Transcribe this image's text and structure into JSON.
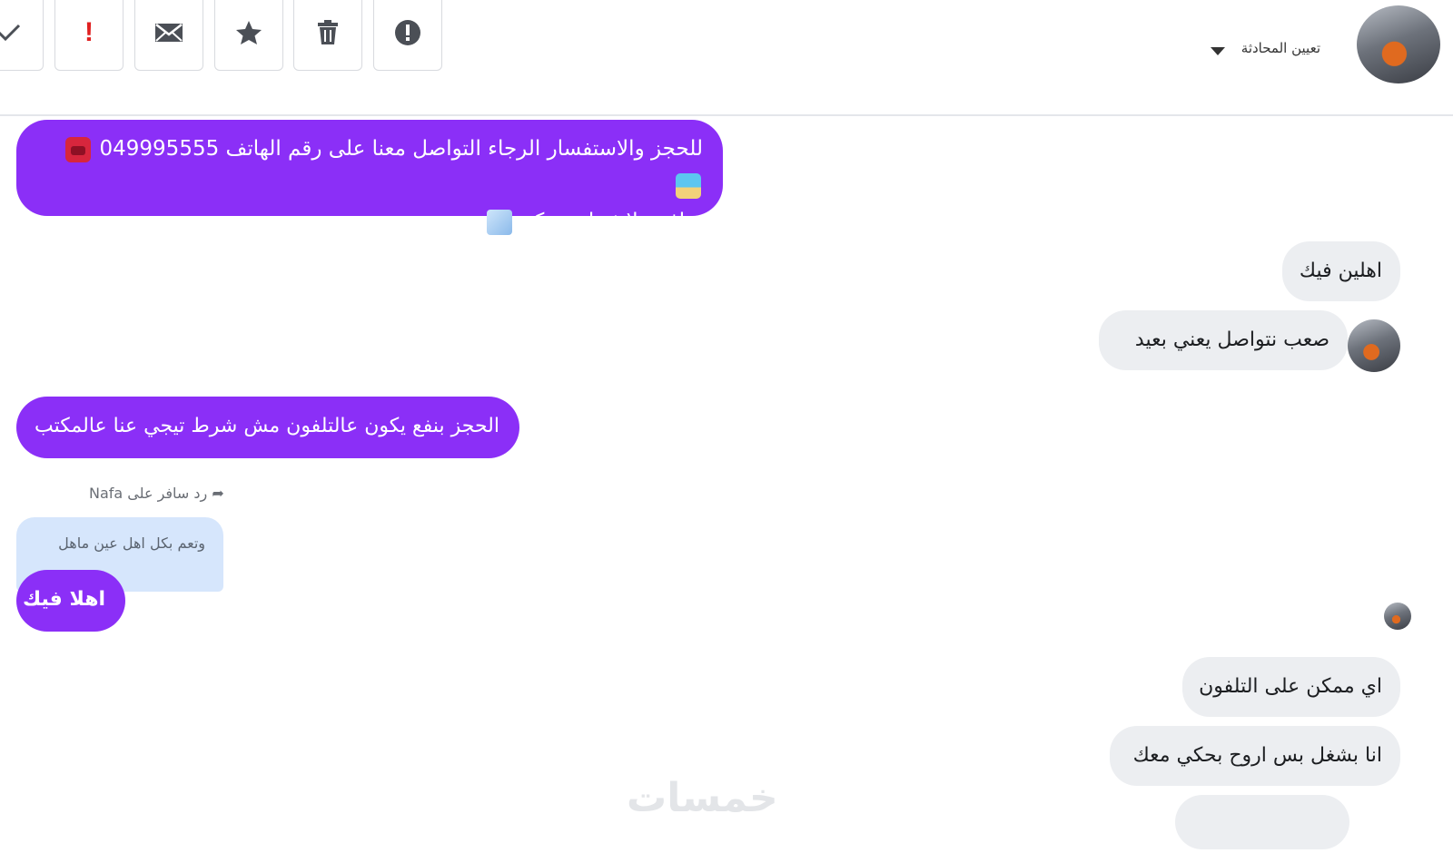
{
  "toolbar": {
    "buttons": [
      {
        "icon": "check-icon"
      },
      {
        "icon": "exclamation-icon",
        "label": "!"
      },
      {
        "icon": "envelope-icon"
      },
      {
        "icon": "star-icon"
      },
      {
        "icon": "trash-icon"
      },
      {
        "icon": "alert-circle-icon"
      }
    ],
    "assign_label": "تعيين المحادثة"
  },
  "messages": {
    "m1_line1": "للحجز والاستفسار الرجاء التواصل معنا على رقم الهاتف 049995555",
    "m1_line2": "سافر ببلاش لخدمتكم",
    "m2": "اهلين فيك",
    "m3": "صعب نتواصل يعني بعيد",
    "m4": "الحجز بنفع يكون عالتلفون مش شرط تيجي عنا عالمكتب",
    "reply_meta": "رد سافر على Nafa",
    "quoted": "وتعم بكل اهل عين ماهل",
    "m5": "اهلا فيك",
    "m6": "اي ممكن على التلفون",
    "m7": "انا بشغل بس اروح بحكي معك"
  },
  "watermark": "خمسات",
  "colors": {
    "page_bubble": "#8b2ff7",
    "user_bubble": "#eceef1",
    "quote_bubble": "#d6e6fc"
  }
}
